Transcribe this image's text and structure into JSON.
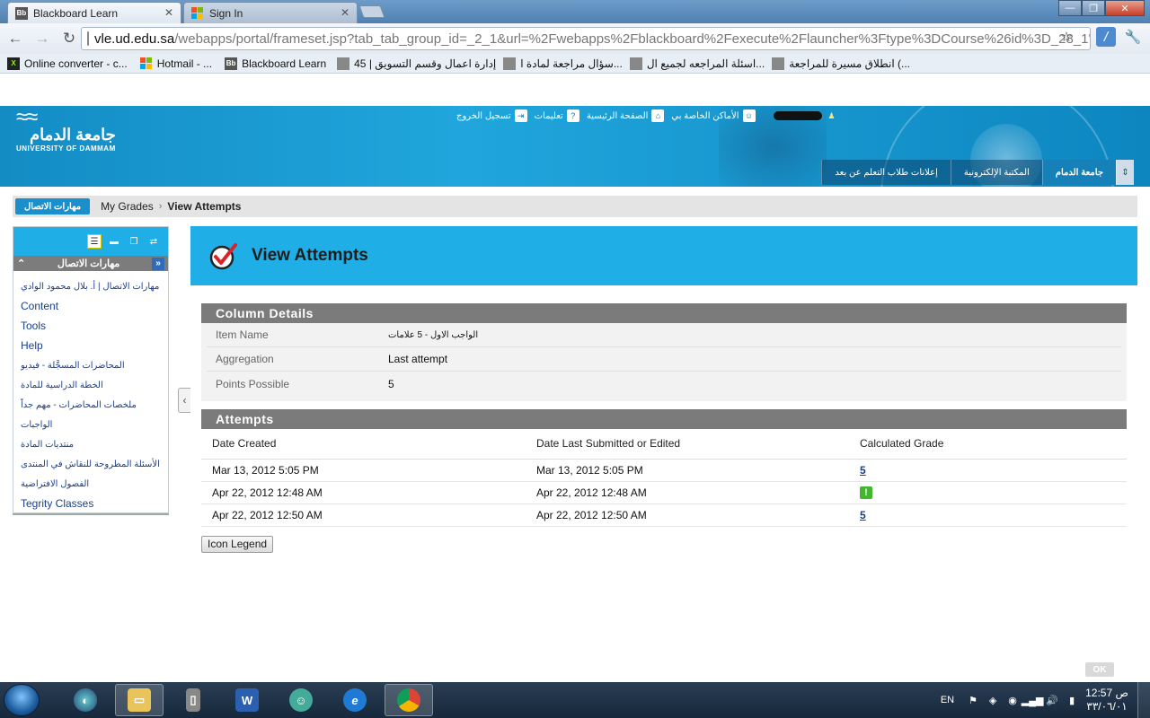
{
  "browser": {
    "tabs": [
      {
        "label": "Blackboard Learn",
        "favicon": "Bb",
        "active": true
      },
      {
        "label": "Sign In",
        "favicon": "ms-window",
        "active": false
      }
    ],
    "url_host": "vle.ud.edu.sa",
    "url_rest": "/webapps/portal/frameset.jsp?tab_tab_group_id=_2_1&url=%2Fwebapps%2Fblackboard%2Fexecute%2Flauncher%3Ftype%3DCourse%26id%3D_28_1'",
    "bookmarks": [
      "Online converter - c...",
      "Hotmail - ...",
      "Blackboard Learn",
      "إدارة اعمال وقسم التسويق | 45",
      "سؤال مراجعة لمادة ا...",
      "اسئلة المراجعه لجميع ال...",
      "انطلاق مسيرة للمراجعة (..."
    ]
  },
  "banner": {
    "logo_ar": "جامعة الدمام",
    "logo_en": "UNIVERSITY OF DAMMAM",
    "top_links": {
      "logout": "تسجيل الخروج",
      "help": "تعليمات",
      "home": "الصفحة الرئيسية",
      "my_places": "الأماكن الخاصة بي"
    },
    "main_tabs": [
      "إعلانات طلاب التعلم عن بعد",
      "المكتبة الإلكترونية",
      "جامعة الدمام"
    ],
    "colors": {
      "banner": "#1faee6",
      "tab_active": "#1581b8"
    }
  },
  "breadcrumb": {
    "course": "مهارات الاتصال",
    "parent": "My Grades",
    "current": "View Attempts"
  },
  "course_menu": {
    "title": "مهارات الاتصال",
    "items": [
      "مهارات الاتصال | أ. بلال محمود الوادي",
      "Content",
      "Tools",
      "Help",
      "المحاضرات المسجَّلة - فيديو",
      "الخطة الدراسية للمادة",
      "ملخصات المحاضرات - مهم جداً",
      "الواجبات",
      "منتديات المادة",
      "الأسئلة المطروحة للنقاش في المنتدى",
      "الفصول الافتراضية",
      "Tegrity Classes"
    ]
  },
  "page": {
    "title": "View Attempts",
    "column_details": {
      "heading": "Column Details",
      "rows": [
        {
          "label": "Item Name",
          "value": "الواجب الاول - 5 علامات"
        },
        {
          "label": "Aggregation",
          "value": "Last attempt"
        },
        {
          "label": "Points Possible",
          "value": "5"
        }
      ]
    },
    "attempts": {
      "heading": "Attempts",
      "columns": [
        "Date Created",
        "Date Last Submitted or Edited",
        "Calculated Grade"
      ],
      "rows": [
        {
          "created": "Mar 13, 2012 5:05 PM",
          "submitted": "Mar 13, 2012 5:05 PM",
          "grade": "5"
        },
        {
          "created": "Apr 22, 2012 12:48 AM",
          "submitted": "Apr 22, 2012 12:48 AM",
          "grade": "!"
        },
        {
          "created": "Apr 22, 2012 12:50 AM",
          "submitted": "Apr 22, 2012 12:50 AM",
          "grade": "5"
        }
      ]
    },
    "icon_legend_label": "Icon Legend",
    "ok_label": "OK"
  },
  "taskbar": {
    "lang": "EN",
    "time": "12:57 ص",
    "date": "٣٣/٠٦/٠١"
  }
}
